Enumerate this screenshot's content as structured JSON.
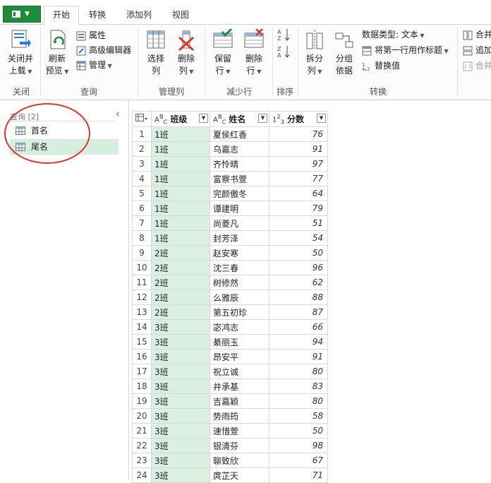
{
  "tabs": [
    "开始",
    "转换",
    "添加列",
    "视图"
  ],
  "ribbon": {
    "close": {
      "label1": "关闭并",
      "label2": "上载",
      "group": "关闭"
    },
    "refresh": {
      "label1": "刷新",
      "label2": "预览"
    },
    "props": "属性",
    "adv_editor": "高级编辑器",
    "manage": "管理",
    "query_group": "查询",
    "choose_cols": {
      "label1": "选择",
      "label2": "列"
    },
    "remove_cols": {
      "label1": "删除",
      "label2": "列"
    },
    "manage_cols_group": "管理列",
    "keep_rows": {
      "label1": "保留",
      "label2": "行"
    },
    "remove_rows": {
      "label1": "删除",
      "label2": "行"
    },
    "reduce_rows_group": "减少行",
    "sort_group": "排序",
    "split": {
      "label1": "拆分",
      "label2": "列"
    },
    "groupby": {
      "label1": "分组",
      "label2": "依据"
    },
    "datatype": "数据类型: 文本",
    "first_row_header": "将第一行用作标题",
    "replace": "替换值",
    "transform_group": "转换",
    "merge": "合并",
    "append": "追加",
    "combine": "合并"
  },
  "queries": {
    "header": "查询 [2]",
    "items": [
      "首名",
      "尾名"
    ]
  },
  "table": {
    "headers": [
      "班级",
      "姓名",
      "分数"
    ],
    "rows": [
      [
        "1",
        "1班",
        "夏侯红香",
        "76"
      ],
      [
        "2",
        "1班",
        "乌嘉志",
        "91"
      ],
      [
        "3",
        "1班",
        "齐怜晴",
        "97"
      ],
      [
        "4",
        "1班",
        "富察书萱",
        "77"
      ],
      [
        "5",
        "1班",
        "完颜傲冬",
        "64"
      ],
      [
        "6",
        "1班",
        "谭建明",
        "79"
      ],
      [
        "7",
        "1班",
        "尚菱凡",
        "51"
      ],
      [
        "8",
        "1班",
        "封芳泽",
        "54"
      ],
      [
        "9",
        "2班",
        "赵安寒",
        "50"
      ],
      [
        "10",
        "2班",
        "沈三春",
        "96"
      ],
      [
        "11",
        "2班",
        "树修然",
        "62"
      ],
      [
        "12",
        "2班",
        "么雅辰",
        "88"
      ],
      [
        "13",
        "2班",
        "第五初珍",
        "87"
      ],
      [
        "14",
        "3班",
        "宓鸿志",
        "66"
      ],
      [
        "15",
        "3班",
        "綦丽玉",
        "94"
      ],
      [
        "16",
        "3班",
        "昂安平",
        "91"
      ],
      [
        "17",
        "3班",
        "祝立诚",
        "80"
      ],
      [
        "18",
        "3班",
        "井承基",
        "83"
      ],
      [
        "19",
        "3班",
        "吉嘉颖",
        "80"
      ],
      [
        "20",
        "3班",
        "势雨筠",
        "58"
      ],
      [
        "21",
        "3班",
        "速惜萱",
        "50"
      ],
      [
        "22",
        "3班",
        "银清芬",
        "98"
      ],
      [
        "23",
        "3班",
        "聊致欣",
        "67"
      ],
      [
        "24",
        "3班",
        "庹芷天",
        "71"
      ]
    ]
  },
  "colors": {
    "accent": "#1f8c3b",
    "selected": "#d6eedd",
    "highlight_circle": "#e23030"
  }
}
